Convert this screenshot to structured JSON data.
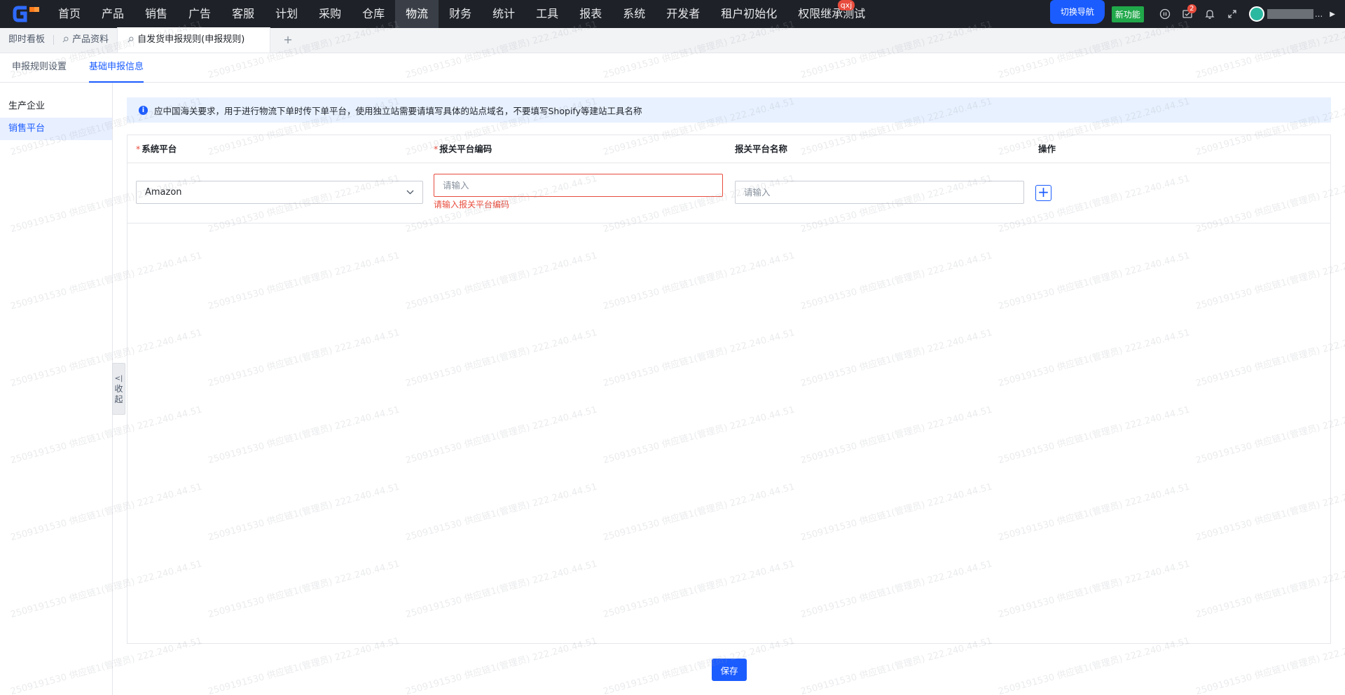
{
  "brand": {
    "logo_text": "G"
  },
  "nav": {
    "items": [
      {
        "label": "首页",
        "active": false
      },
      {
        "label": "产品",
        "active": false
      },
      {
        "label": "销售",
        "active": false
      },
      {
        "label": "广告",
        "active": false
      },
      {
        "label": "客服",
        "active": false
      },
      {
        "label": "计划",
        "active": false
      },
      {
        "label": "采购",
        "active": false
      },
      {
        "label": "仓库",
        "active": false
      },
      {
        "label": "物流",
        "active": true
      },
      {
        "label": "财务",
        "active": false
      },
      {
        "label": "统计",
        "active": false
      },
      {
        "label": "工具",
        "active": false
      },
      {
        "label": "报表",
        "active": false
      },
      {
        "label": "系统",
        "active": false
      },
      {
        "label": "开发者",
        "active": false
      },
      {
        "label": "租户初始化",
        "active": false
      },
      {
        "label": "权限继承测试",
        "active": false,
        "badge": "qxj"
      }
    ],
    "switch_nav": "切换导航",
    "new_feature": "新功能",
    "message_count": "2",
    "user_suffix": "...",
    "icons": [
      "help-icon",
      "message-icon",
      "bell-icon",
      "fullscreen-icon"
    ]
  },
  "tabs": {
    "items": [
      {
        "label": "即时看板",
        "active": false,
        "pinned": false
      },
      {
        "label": "产品资料",
        "active": false,
        "pinned": true
      },
      {
        "label": "自发货申报规则(申报规则)",
        "active": true,
        "pinned": true
      }
    ],
    "add": "+"
  },
  "subtabs": {
    "items": [
      {
        "label": "申报规则设置",
        "active": false
      },
      {
        "label": "基础申报信息",
        "active": true
      }
    ]
  },
  "side": {
    "items": [
      {
        "label": "生产企业",
        "active": false
      },
      {
        "label": "销售平台",
        "active": true
      }
    ],
    "collapse_icon": "<|",
    "collapse_label_1": "收",
    "collapse_label_2": "起"
  },
  "alert": {
    "text": "应中国海关要求，用于进行物流下单时传下单平台，使用独立站需要请填写具体的站点域名，不要填写Shopify等建站工具名称"
  },
  "table": {
    "columns": [
      {
        "label": "系统平台",
        "required": true
      },
      {
        "label": "报关平台编码",
        "required": true
      },
      {
        "label": "报关平台名称",
        "required": false
      },
      {
        "label": "操作",
        "required": false
      }
    ],
    "row": {
      "platform": "Amazon",
      "code_placeholder": "请输入",
      "code_value": "",
      "code_error": "请输入报关平台编码",
      "name_placeholder": "请输入",
      "name_value": ""
    }
  },
  "save_label": "保存",
  "watermark": "2509191530 供应链1(管理员) 222.240.44.51",
  "colors": {
    "accent": "#1b5cff",
    "error": "#e84c3d",
    "topbar": "#1e2127",
    "new_feature": "#20a84a"
  }
}
